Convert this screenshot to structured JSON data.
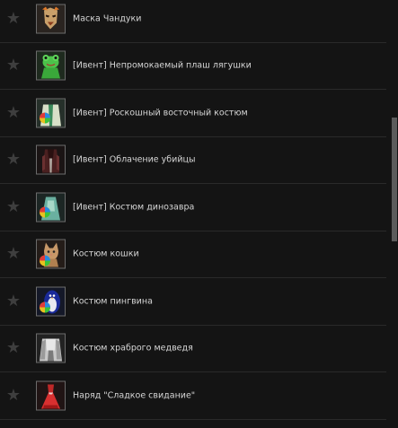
{
  "items": [
    {
      "label": "Маска Чандуки",
      "icon": "mask-icon"
    },
    {
      "label": "[Ивент] Непромокаемый плаш лягушки",
      "icon": "frog-raincoat-icon"
    },
    {
      "label": "[Ивент] Роскошный восточный костюм",
      "icon": "eastern-costume-icon"
    },
    {
      "label": "[Ивент] Облачение убийцы",
      "icon": "assassin-outfit-icon"
    },
    {
      "label": "[Ивент] Костюм динозавра",
      "icon": "dinosaur-costume-icon"
    },
    {
      "label": "Костюм кошки",
      "icon": "cat-costume-icon"
    },
    {
      "label": "Костюм пингвина",
      "icon": "penguin-costume-icon"
    },
    {
      "label": "Костюм храброго медведя",
      "icon": "bear-costume-icon"
    },
    {
      "label": "Наряд \"Сладкое свидание\"",
      "icon": "red-dress-icon"
    }
  ],
  "star_icon": "star-icon"
}
